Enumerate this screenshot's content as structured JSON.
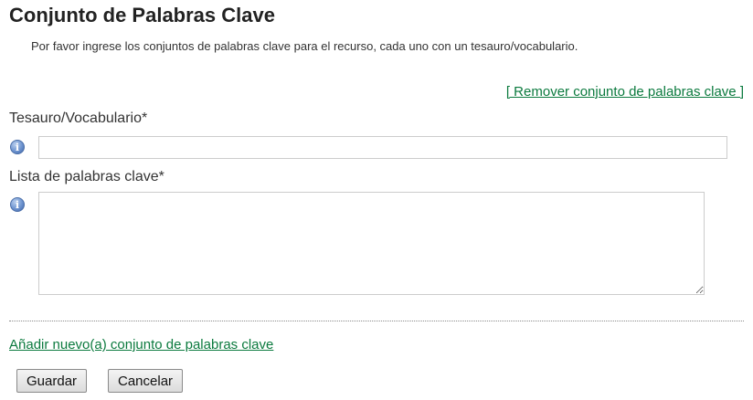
{
  "section": {
    "title": "Conjunto de Palabras Clave",
    "description": "Por favor ingrese los conjuntos de palabras clave para el recurso, cada uno con un tesauro/vocabulario.",
    "remove_link": "[ Remover conjunto de palabras clave ]"
  },
  "fields": {
    "thesaurus": {
      "label": "Tesauro/Vocabulario*",
      "value": "",
      "icon": "info-icon"
    },
    "keywords": {
      "label": "Lista de palabras clave*",
      "value": "",
      "icon": "info-icon"
    }
  },
  "add_link": "Añadir nuevo(a) conjunto de palabras clave",
  "buttons": {
    "save": "Guardar",
    "cancel": "Cancelar"
  },
  "colors": {
    "link": "#0b7a3e",
    "info_icon": "#5a82c4"
  }
}
